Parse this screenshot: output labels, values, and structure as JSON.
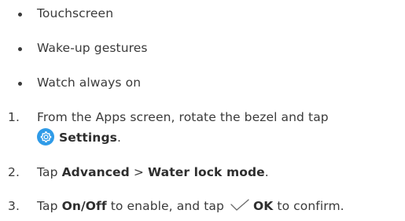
{
  "bullets": [
    {
      "text": "Touchscreen"
    },
    {
      "text": "Wake-up gestures"
    },
    {
      "text": "Watch always on"
    }
  ],
  "steps": [
    {
      "number": "1.",
      "line1": "From the Apps screen, rotate the bezel and tap",
      "icon": "settings-gear-icon",
      "bold": "Settings",
      "after": "."
    },
    {
      "number": "2.",
      "prefix": "Tap ",
      "bold1": "Advanced",
      "separator": " > ",
      "bold2": "Water lock mode",
      "after": "."
    },
    {
      "number": "3.",
      "prefix": "Tap ",
      "bold1": "On/Off",
      "middle": " to enable, and tap ",
      "icon": "checkmark-icon",
      "bold2": "OK",
      "after": " to confirm."
    }
  ],
  "colors": {
    "text": "#3a3a3a",
    "settings_icon_bg": "#2f9be8",
    "checkmark": "#4a4a4a"
  }
}
